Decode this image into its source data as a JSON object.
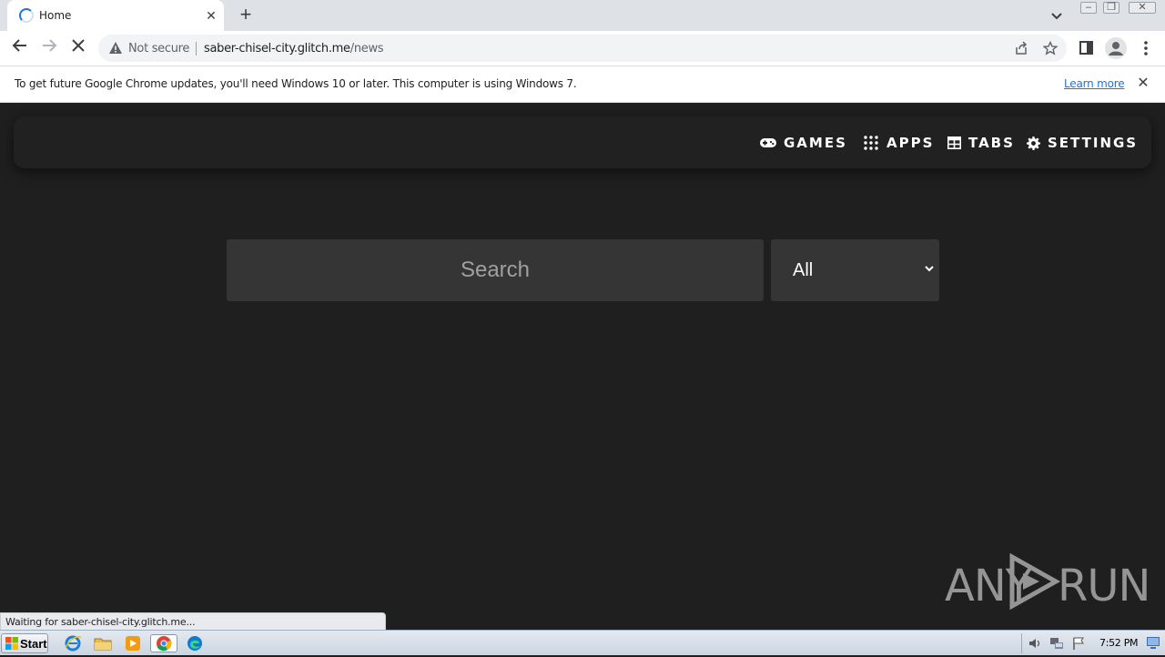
{
  "browser": {
    "tab": {
      "title": "Home",
      "close_label": "✕"
    },
    "new_tab_label": "+",
    "address": {
      "security_label": "Not secure",
      "url_host": "saber-chisel-city.glitch.me",
      "url_path": "/news"
    },
    "infobar": {
      "message": "To get future Google Chrome updates, you'll need Windows 10 or later. This computer is using Windows 7.",
      "link": "Learn more",
      "close_label": "✕"
    },
    "status_text": "Waiting for saber-chisel-city.glitch.me..."
  },
  "site": {
    "nav": [
      {
        "label": "GAMES",
        "icon": "gamepad-icon"
      },
      {
        "label": "APPS",
        "icon": "grid-icon"
      },
      {
        "label": "TABS",
        "icon": "tabs-icon"
      },
      {
        "label": "SETTINGS",
        "icon": "gear-icon"
      }
    ],
    "search": {
      "placeholder": "Search",
      "value": ""
    },
    "filter": {
      "selected": "All"
    }
  },
  "watermark": {
    "left": "ANY",
    "right": "RUN"
  },
  "taskbar": {
    "start_label": "Start",
    "clock": "7:52 PM"
  },
  "colors": {
    "page_bg": "#1f1f1f",
    "navbar_bg": "#212121",
    "input_bg": "#353535",
    "link_blue": "#1a73e8"
  }
}
